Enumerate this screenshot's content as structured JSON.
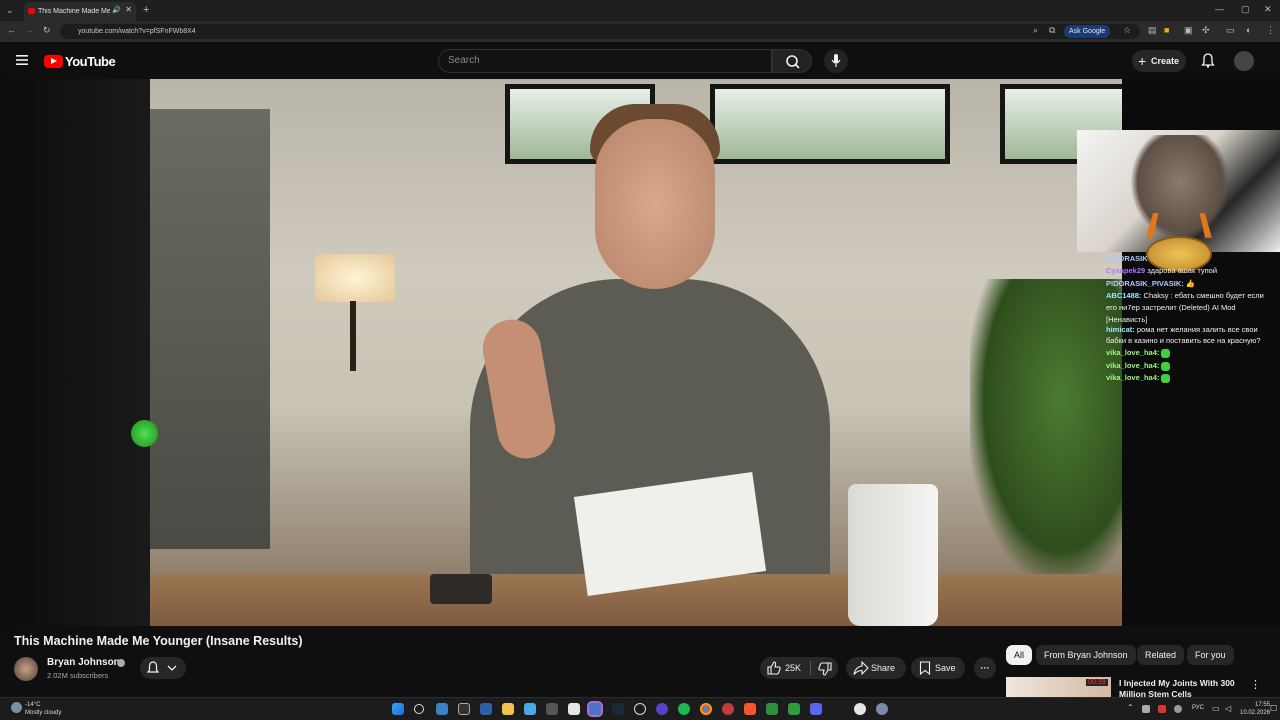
{
  "browser": {
    "tab_title": "This Machine Made Me Yo",
    "url": "youtube.com/watch?v=pfSFnFWb8X4",
    "ask_google": "Ask Google"
  },
  "header": {
    "logo_text": "YouTube",
    "search_placeholder": "Search",
    "create_label": "Create"
  },
  "video": {
    "title": "This Machine Made Me Younger (Insane Results)",
    "channel": "Bryan Johnson",
    "subscribers": "2.02M subscribers",
    "likes": "25K",
    "share_label": "Share",
    "save_label": "Save"
  },
  "chat": [
    {
      "user": "PIDORASIK",
      "text": ""
    },
    {
      "user": "Cyxapek29",
      "text": "здарова ашак тупой"
    },
    {
      "user": "PIDORASIK_PIVASIK:",
      "text": "👍"
    },
    {
      "user": "ABC1488:",
      "text": "Chaksy : ебать смешно будет если"
    },
    {
      "user": "",
      "text": "его ни7ер застрелит (Deleted) AI Mod"
    },
    {
      "user": "",
      "text": "[Ненависть]"
    },
    {
      "user": "himicat:",
      "text": "рома нет желания залить все свои"
    },
    {
      "user": "",
      "text": "бабки в казино и поставить все на красную?"
    },
    {
      "user": "vika_love_ha4:",
      "text": ""
    },
    {
      "user": "vika_love_ha4:",
      "text": ""
    },
    {
      "user": "vika_love_ha4:",
      "text": ""
    }
  ],
  "chips": [
    "All",
    "From Bryan Johnson",
    "Related",
    "For you"
  ],
  "recommendation": {
    "title": "I Injected My Joints With 300 Million Stem Cells",
    "duration": "00:39"
  },
  "taskbar": {
    "temperature": "-14°C",
    "weather": "Mostly cloudy",
    "language": "РУС",
    "time": "17:55",
    "date": "10.02.2026"
  },
  "colors": {
    "brand": "#ff0000",
    "background": "#0f0f0f",
    "pill": "#272727"
  }
}
